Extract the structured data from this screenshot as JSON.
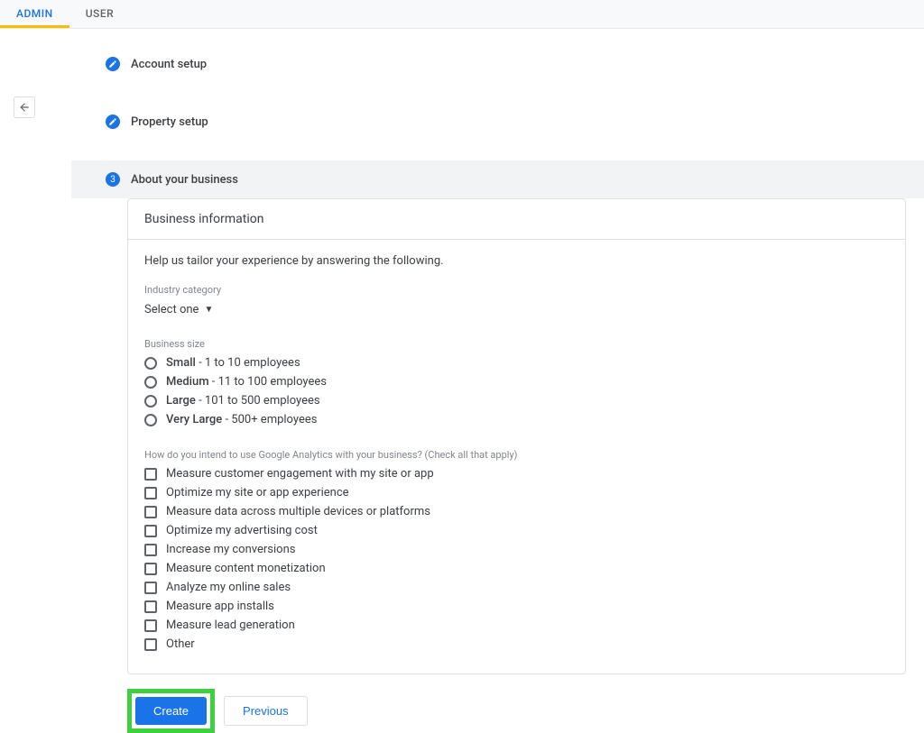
{
  "tabs": {
    "admin": "ADMIN",
    "user": "USER"
  },
  "steps": {
    "account": "Account setup",
    "property": "Property setup",
    "business": "About your business",
    "business_num": "3"
  },
  "card": {
    "title": "Business information",
    "help": "Help us tailor your experience by answering the following.",
    "industry_label": "Industry category",
    "industry_select": "Select one",
    "size_label": "Business size",
    "sizes": [
      {
        "bold": "Small",
        "rest": " - 1 to 10 employees"
      },
      {
        "bold": "Medium",
        "rest": " - 11 to 100 employees"
      },
      {
        "bold": "Large",
        "rest": " - 101 to 500 employees"
      },
      {
        "bold": "Very Large",
        "rest": " - 500+ employees"
      }
    ],
    "intent_label": "How do you intend to use Google Analytics with your business? (Check all that apply)",
    "intents": [
      "Measure customer engagement with my site or app",
      "Optimize my site or app experience",
      "Measure data across multiple devices or platforms",
      "Optimize my advertising cost",
      "Increase my conversions",
      "Measure content monetization",
      "Analyze my online sales",
      "Measure app installs",
      "Measure lead generation",
      "Other"
    ]
  },
  "actions": {
    "create": "Create",
    "previous": "Previous"
  }
}
